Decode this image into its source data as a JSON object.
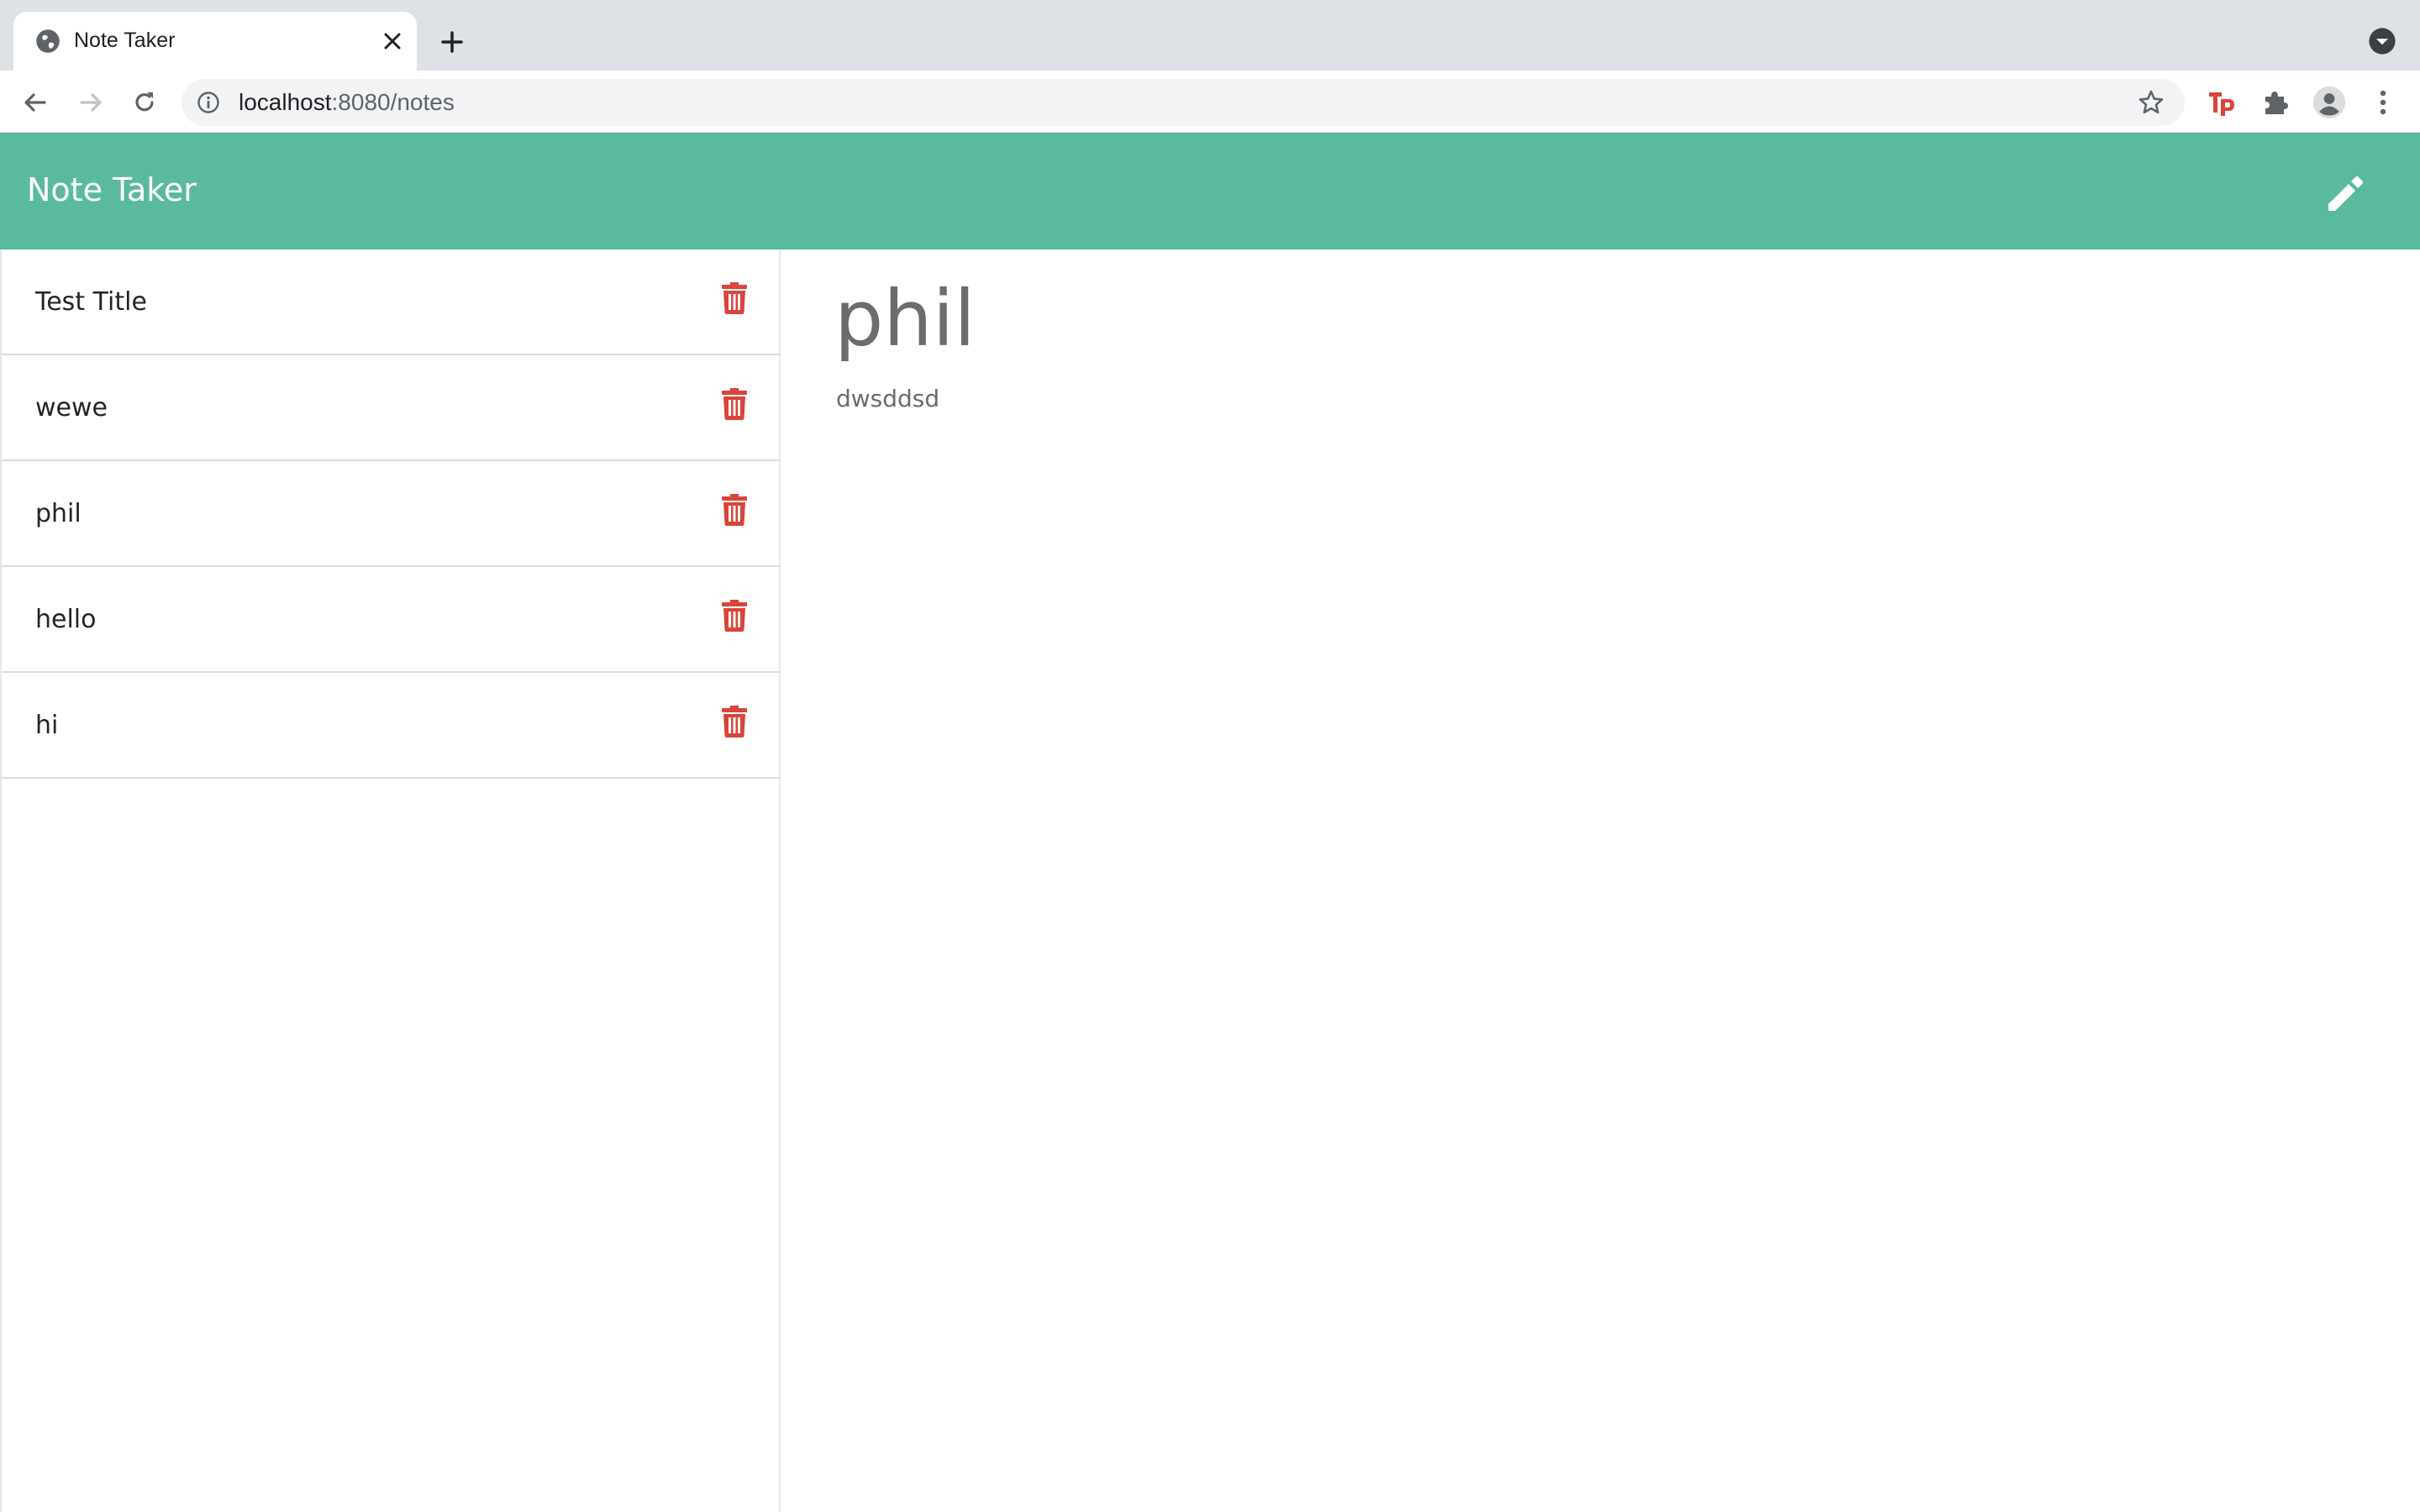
{
  "browser": {
    "tab_title": "Note Taker",
    "url_host": "localhost",
    "url_path": ":8080/notes"
  },
  "colors": {
    "header": "#5aba9d",
    "delete": "#d9443a",
    "text_muted": "#6c6c6c"
  },
  "header": {
    "title": "Note Taker",
    "action_icon": "pencil-icon"
  },
  "sidebar": {
    "notes": [
      {
        "title": "Test Title"
      },
      {
        "title": "wewe"
      },
      {
        "title": "phil"
      },
      {
        "title": "hello"
      },
      {
        "title": "hi"
      }
    ],
    "delete_icon": "trash-icon"
  },
  "active_note": {
    "title": "phil",
    "text": "dwsddsd"
  }
}
